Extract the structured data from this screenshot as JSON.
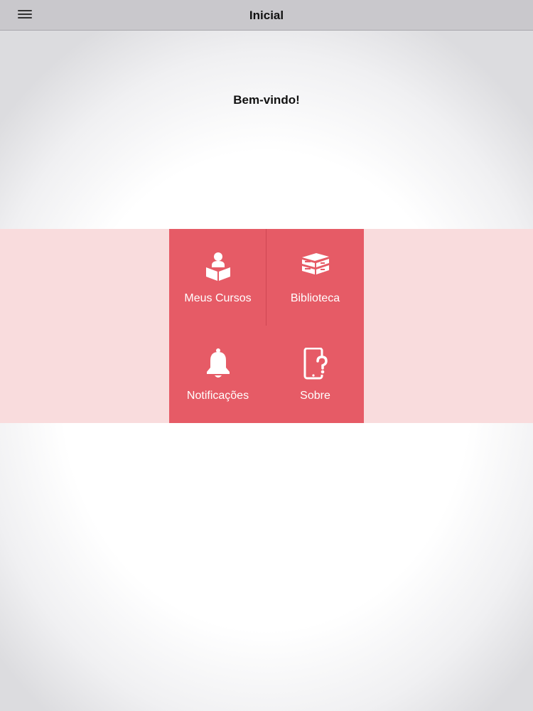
{
  "navbar": {
    "title": "Inicial",
    "menu_icon": "hamburger-menu-icon",
    "background": "#c9c8cc"
  },
  "main": {
    "welcome": "Bem-vindo!"
  },
  "tiles": [
    {
      "label": "Meus Cursos",
      "icon": "student-reading-icon"
    },
    {
      "label": "Biblioteca",
      "icon": "books-stack-icon"
    },
    {
      "label": "Notificações",
      "icon": "bell-icon"
    },
    {
      "label": "Sobre",
      "icon": "phone-question-icon"
    }
  ],
  "colors": {
    "accent": "#e65b66",
    "band": "#f9dcdd",
    "tile_text": "#ffffff"
  }
}
